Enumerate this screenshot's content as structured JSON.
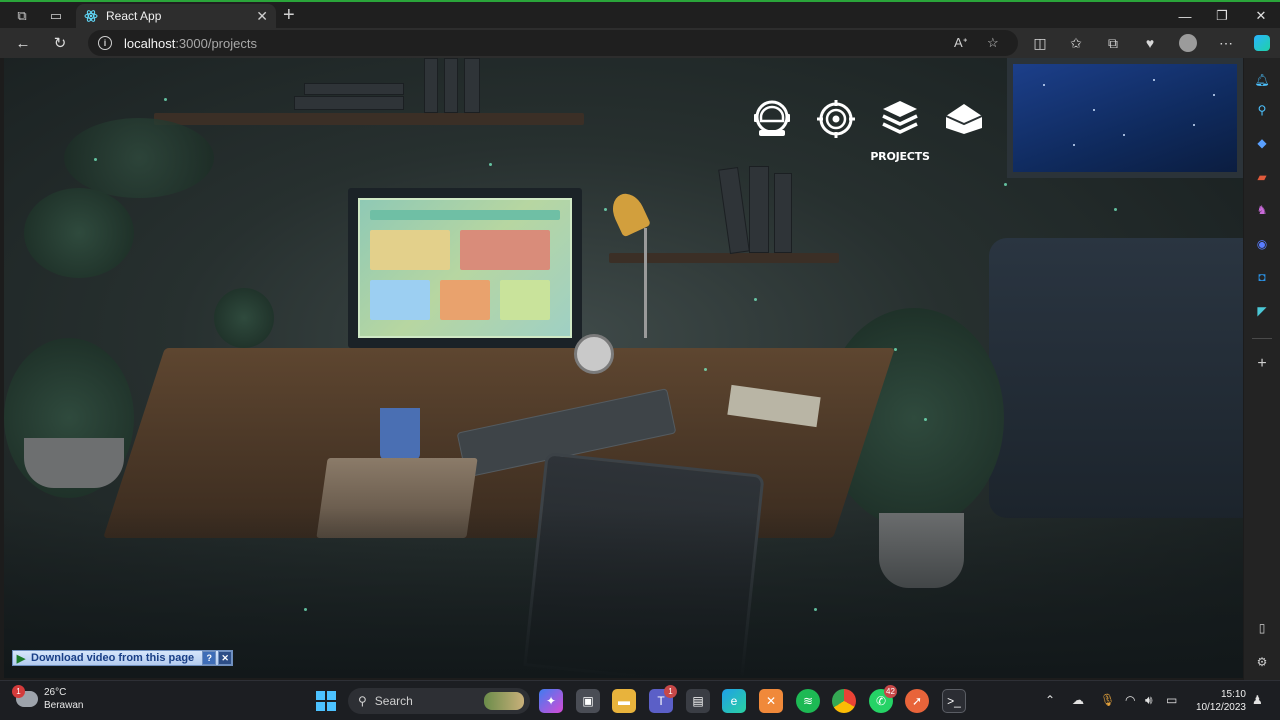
{
  "browser": {
    "tab_title": "React App",
    "url_host": "localhost",
    "url_path": ":3000/projects"
  },
  "site_nav": {
    "items": [
      {
        "icon": "astronaut-helmet-icon"
      },
      {
        "icon": "target-icon"
      },
      {
        "icon": "layers-icon",
        "label": "PROJECTS"
      },
      {
        "icon": "envelope-icon"
      }
    ]
  },
  "download_bar": {
    "label": "Download video from this page",
    "help": "?",
    "close": "✕"
  },
  "taskbar": {
    "weather_temp": "26°C",
    "weather_desc": "Berawan",
    "weather_badge": "1",
    "search_label": "Search",
    "teams_badge": "1",
    "whatsapp_badge": "42",
    "time": "15:10",
    "date": "10/12/2023"
  },
  "colors": {
    "accent_green": "#2aa53a",
    "edge_blue": "#4cc2ff",
    "nav_white": "#ffffff"
  }
}
